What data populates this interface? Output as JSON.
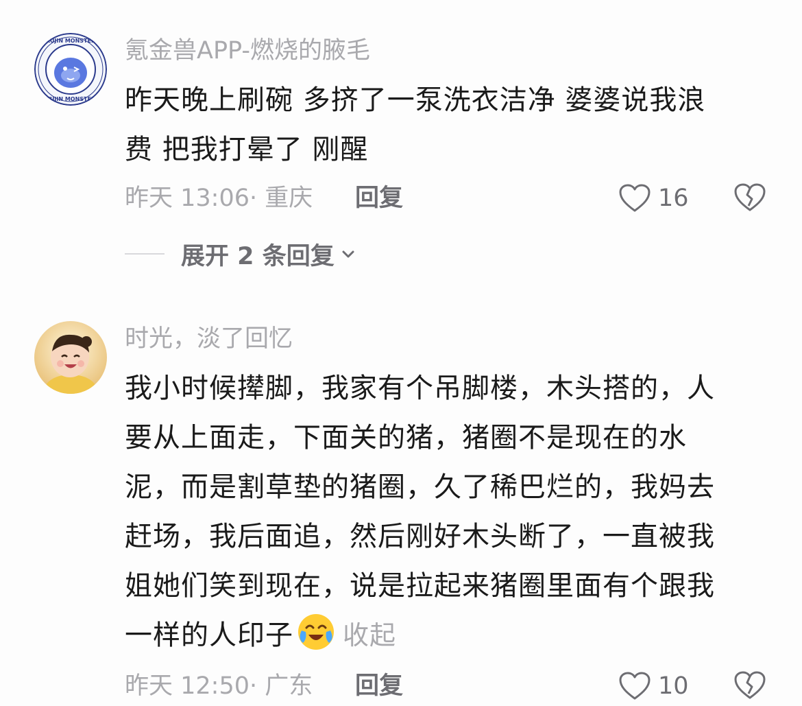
{
  "comments": [
    {
      "username": "氪金兽APP-燃烧的腋毛",
      "avatar": "kujin-monster-avatar",
      "lines": [
        "昨天晚上刷碗 多挤了一泵洗衣洁净 婆婆说我浪",
        "费 把我打晕了 刚醒"
      ],
      "time_location": "昨天 13:06· 重庆",
      "reply_label": "回复",
      "likes": "16",
      "expand_label": "展开 2 条回复"
    },
    {
      "username": "时光，淡了回忆",
      "avatar": "child-photo-avatar",
      "lines": [
        "我小时候撵脚，我家有个吊脚楼，木头搭的，人",
        "要从上面走，下面关的猪，猪圈不是现在的水",
        "泥，而是割草垫的猪圈，久了稀巴烂的，我妈去",
        "赶场，我后面追，然后刚好木头断了，一直被我",
        "姐她们笑到现在，说是拉起来猪圈里面有个跟我",
        "一样的人印子"
      ],
      "emoji": "crying-laughing-emoji",
      "collapse_label": "收起",
      "time_location": "昨天 12:50· 广东",
      "reply_label": "回复",
      "likes": "10"
    }
  ],
  "colors": {
    "background": "#fdfdfd",
    "text": "#1a1a1a",
    "secondary": "#a9a9ad",
    "action": "#6d6d72"
  }
}
